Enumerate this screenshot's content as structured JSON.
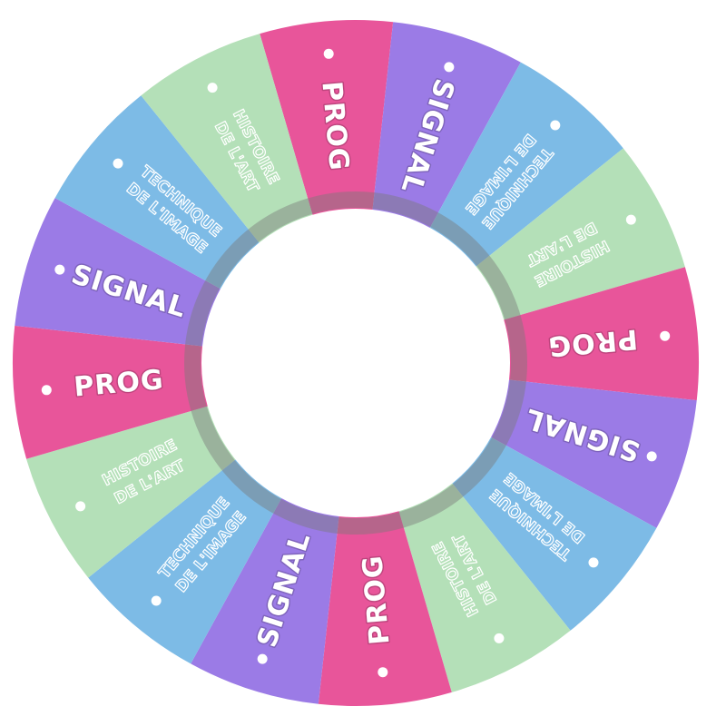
{
  "wheel": {
    "colors": {
      "prog": "#e8559a",
      "signal": "#9b7be6",
      "technique": "#7dbbe6",
      "histoire": "#b4e0b8",
      "inner_ring": "#7a7a7a",
      "hub": "#ffffff",
      "dot": "#ffffff"
    },
    "segments": [
      {
        "category": "prog",
        "lines": [
          "PROG"
        ]
      },
      {
        "category": "signal",
        "lines": [
          "SIGNAL"
        ]
      },
      {
        "category": "technique",
        "lines": [
          "TECHNIQUE",
          "DE L'IMAGE"
        ]
      },
      {
        "category": "histoire",
        "lines": [
          "HISTOIRE",
          "DE L'ART"
        ]
      },
      {
        "category": "prog",
        "lines": [
          "PROG"
        ]
      },
      {
        "category": "signal",
        "lines": [
          "SIGNAL"
        ]
      },
      {
        "category": "technique",
        "lines": [
          "TECHNIQUE",
          "DE L'IMAGE"
        ]
      },
      {
        "category": "histoire",
        "lines": [
          "HISTOIRE",
          "DE L'ART"
        ]
      },
      {
        "category": "prog",
        "lines": [
          "PROG"
        ]
      },
      {
        "category": "signal",
        "lines": [
          "SIGNAL"
        ]
      },
      {
        "category": "technique",
        "lines": [
          "TECHNIQUE",
          "DE L'IMAGE"
        ]
      },
      {
        "category": "histoire",
        "lines": [
          "HISTOIRE",
          "DE L'ART"
        ]
      },
      {
        "category": "prog",
        "lines": [
          "PROG"
        ]
      },
      {
        "category": "signal",
        "lines": [
          "SIGNAL"
        ]
      },
      {
        "category": "technique",
        "lines": [
          "TECHNIQUE",
          "DE L'IMAGE"
        ]
      },
      {
        "category": "histoire",
        "lines": [
          "HISTOIRE",
          "DE L'ART"
        ]
      }
    ]
  }
}
